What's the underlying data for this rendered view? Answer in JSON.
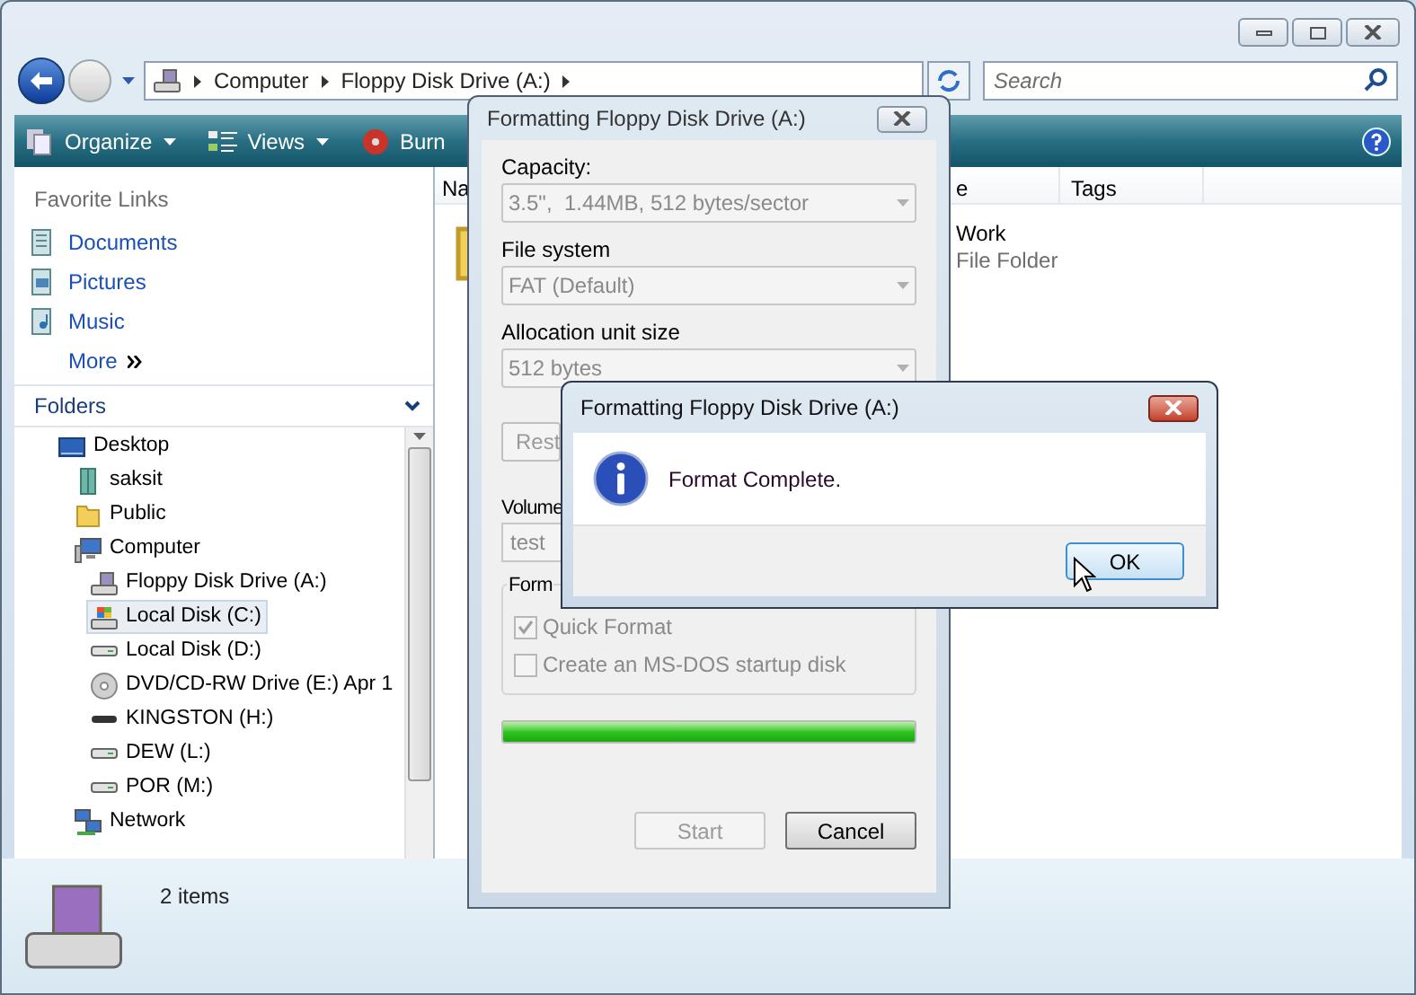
{
  "address_bar": {
    "crumbs": [
      "Computer",
      "Floppy Disk Drive (A:)"
    ]
  },
  "search": {
    "placeholder": "Search"
  },
  "toolbar": {
    "items": [
      {
        "label": "Organize",
        "kind": "organize",
        "has_menu": true
      },
      {
        "label": "Views",
        "kind": "views",
        "has_menu": true
      },
      {
        "label": "Burn",
        "kind": "burn",
        "has_menu": false
      }
    ]
  },
  "favorite_links": {
    "title": "Favorite Links",
    "items": [
      {
        "label": "Documents",
        "kind": "documents"
      },
      {
        "label": "Pictures",
        "kind": "pictures"
      },
      {
        "label": "Music",
        "kind": "music"
      }
    ],
    "more": "More"
  },
  "folders": {
    "title": "Folders",
    "tree": [
      {
        "label": "Desktop",
        "kind": "desktop",
        "selected": false,
        "children": [
          {
            "label": "saksit",
            "kind": "user",
            "selected": false
          },
          {
            "label": "Public",
            "kind": "folder",
            "selected": false
          },
          {
            "label": "Computer",
            "kind": "computer",
            "selected": false,
            "children": [
              {
                "label": "Floppy Disk Drive (A:)",
                "kind": "floppy",
                "selected": false
              },
              {
                "label": "Local Disk (C:)",
                "kind": "system-disk",
                "selected": true
              },
              {
                "label": "Local Disk (D:)",
                "kind": "disk",
                "selected": false
              },
              {
                "label": "DVD/CD-RW Drive (E:) Apr 1",
                "kind": "dvd",
                "selected": false
              },
              {
                "label": "KINGSTON (H:)",
                "kind": "usb",
                "selected": false
              },
              {
                "label": "DEW (L:)",
                "kind": "disk",
                "selected": false
              },
              {
                "label": "POR (M:)",
                "kind": "disk",
                "selected": false
              }
            ]
          },
          {
            "label": "Network",
            "kind": "network",
            "selected": false
          }
        ]
      }
    ]
  },
  "file_list": {
    "columns": [
      "Na",
      "e",
      "Tags"
    ],
    "items": [
      {
        "name": "Work",
        "type": "File Folder"
      }
    ]
  },
  "details_pane": {
    "count": "2 items"
  },
  "format_dialog": {
    "title": "Formatting Floppy Disk Drive (A:)",
    "fields": [
      {
        "label": "Capacity:",
        "value": "3.5\",  1.44MB, 512 bytes/sector"
      },
      {
        "label": "File system",
        "value": "FAT (Default)"
      },
      {
        "label": "Allocation unit size",
        "value": "512 bytes"
      }
    ],
    "restore_button": "Rest",
    "volume_label": "Volume",
    "volume_value": "test",
    "options_title": "Form",
    "options": [
      {
        "label": "Quick Format",
        "checked": true
      },
      {
        "label": "Create an MS-DOS startup disk",
        "checked": false
      }
    ],
    "progress": {
      "level": 1
    },
    "buttons": [
      {
        "label": "Start",
        "disabled": true
      },
      {
        "label": "Cancel",
        "disabled": false
      }
    ]
  },
  "message_box": {
    "title": "Formatting Floppy Disk Drive (A:)",
    "message": "Format Complete.",
    "button": "OK"
  }
}
